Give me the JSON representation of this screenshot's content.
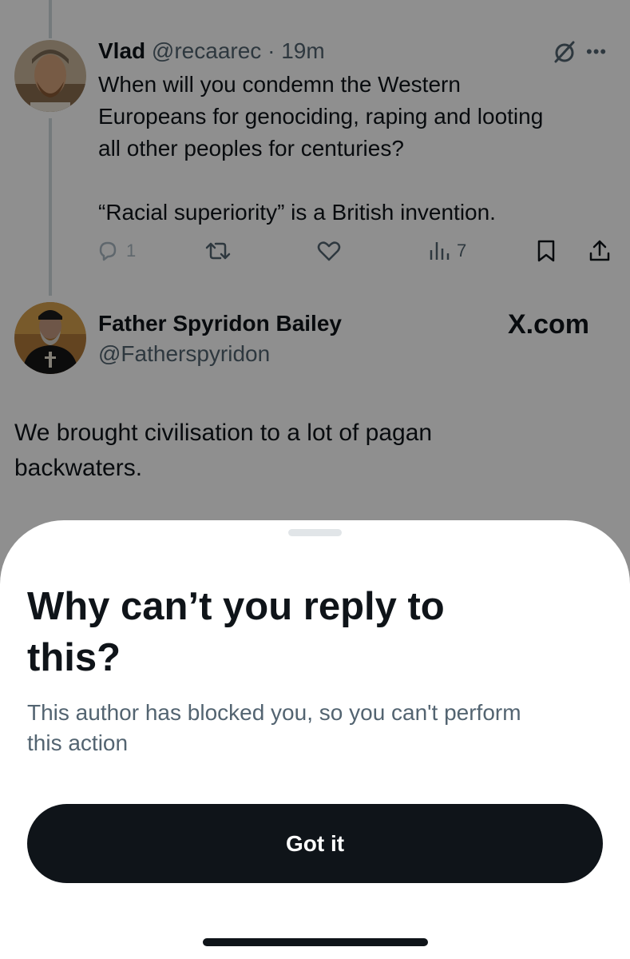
{
  "tweet": {
    "name": "Vlad",
    "handle": "@recaarec",
    "separator": " · ",
    "time": "19m",
    "more_icon": "more-dots-icon",
    "grok_icon": "grok-slash-icon",
    "body": "When will you condemn the Western\nEuropeans for genociding, raping and looting\nall other peoples for centuries?\n\n“Racial superiority” is a British invention.",
    "actions": {
      "reply_count": "1",
      "views_count": "7"
    }
  },
  "quoted": {
    "name": "Father Spyridon Bailey",
    "handle": "@Fatherspyridon",
    "source": "X.com",
    "body": "We brought civilisation to a lot of pagan\nbackwaters."
  },
  "sheet": {
    "title": "Why can’t you reply to\nthis?",
    "description": "This author has blocked you, so you can't perform\nthis action",
    "button_label": "Got it"
  },
  "colors": {
    "text": "#0f1419",
    "secondary": "#536471",
    "overlay": "rgba(0,0,0,0.44)",
    "button_bg": "#0f1419"
  }
}
